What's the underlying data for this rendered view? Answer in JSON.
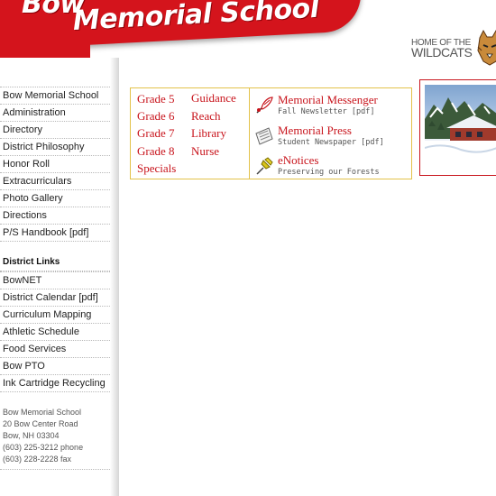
{
  "header": {
    "title_top": "Bow",
    "title_main": "Memorial School",
    "tagline_line1": "HOME OF THE",
    "tagline_line2": "WILDCATS"
  },
  "sidebar": {
    "main_links": [
      "Bow Memorial School",
      "Administration",
      "Directory",
      "District Philosophy",
      "Honor Roll",
      "Extracurriculars",
      "Photo Gallery",
      "Directions",
      "P/S Handbook [pdf]"
    ],
    "district_heading": "District Links",
    "district_links": [
      "BowNET",
      "District Calendar [pdf]",
      "Curriculum Mapping",
      "Athletic Schedule",
      "Food Services",
      "Bow PTO",
      "Ink Cartridge Recycling"
    ],
    "address": {
      "name": "Bow Memorial School",
      "street": "20 Bow Center Road",
      "city": "Bow, NH 03304",
      "phone": "(603) 225-3212 phone",
      "fax": "(603) 228-2228 fax"
    }
  },
  "grades": {
    "col1": [
      "Grade 5",
      "Grade 6",
      "Grade 7",
      "Grade 8",
      "Specials"
    ],
    "col2": [
      "Guidance",
      "Reach",
      "Library",
      "Nurse"
    ]
  },
  "publications": [
    {
      "title": "Memorial Messenger",
      "subtitle": "Fall Newsletter [pdf]",
      "icon": "quill-pen-icon"
    },
    {
      "title": "Memorial Press",
      "subtitle": "Student Newspaper [pdf]",
      "icon": "newspaper-icon"
    },
    {
      "title": "eNotices",
      "subtitle": "Preserving our Forests",
      "icon": "pushpin-icon"
    }
  ],
  "colors": {
    "brand_red": "#d4141c",
    "link_red": "#c8141c",
    "panel_border": "#e3c24a"
  }
}
